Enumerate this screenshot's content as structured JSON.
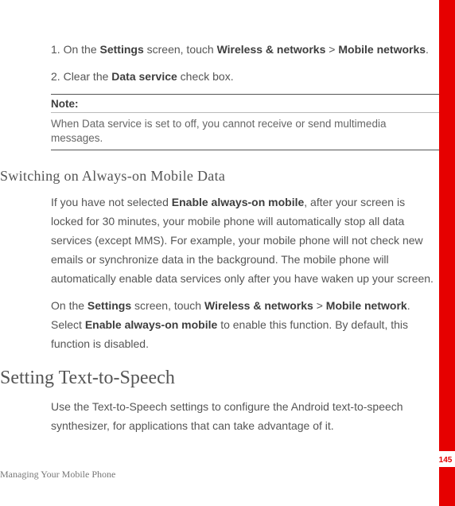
{
  "steps": [
    {
      "num": "1.",
      "parts": [
        {
          "t": "On the ",
          "b": false
        },
        {
          "t": "Settings",
          "b": true
        },
        {
          "t": " screen, touch ",
          "b": false
        },
        {
          "t": "Wireless & networks",
          "b": true
        },
        {
          "t": " > ",
          "b": false
        },
        {
          "t": "Mobile networks",
          "b": true
        },
        {
          "t": ".",
          "b": false
        }
      ]
    },
    {
      "num": "2.",
      "parts": [
        {
          "t": "Clear the ",
          "b": false
        },
        {
          "t": "Data service",
          "b": true
        },
        {
          "t": " check box.",
          "b": false
        }
      ]
    }
  ],
  "note": {
    "label": "Note:",
    "text": "When Data service is set to off, you cannot receive or send multimedia messages."
  },
  "sub_heading": "Switching on Always-on Mobile Data",
  "always_on_paras": [
    [
      {
        "t": "If you have not selected ",
        "b": false
      },
      {
        "t": "Enable always-on mobile",
        "b": true
      },
      {
        "t": ", after your screen is locked for 30 minutes, your mobile phone will automatically stop all data services (except MMS). For example, your mobile phone will not check new emails or synchronize data in the background. The mobile phone will automatically enable data services only after you have waken up your screen.",
        "b": false
      }
    ],
    [
      {
        "t": "On the ",
        "b": false
      },
      {
        "t": "Settings",
        "b": true
      },
      {
        "t": " screen, touch ",
        "b": false
      },
      {
        "t": "Wireless & networks",
        "b": true
      },
      {
        "t": " > ",
        "b": false
      },
      {
        "t": "Mobile network",
        "b": true
      },
      {
        "t": ". Select ",
        "b": false
      },
      {
        "t": "Enable always-on mobile",
        "b": true
      },
      {
        "t": " to enable this function. By default, this function is disabled.",
        "b": false
      }
    ]
  ],
  "main_heading": "Setting Text-to-Speech",
  "tts_para": [
    {
      "t": "Use the Text-to-Speech settings to configure the Android text-to-speech synthesizer, for applications that can take advantage of it.",
      "b": false
    }
  ],
  "page_number": "145",
  "footer": "Managing Your Mobile Phone"
}
